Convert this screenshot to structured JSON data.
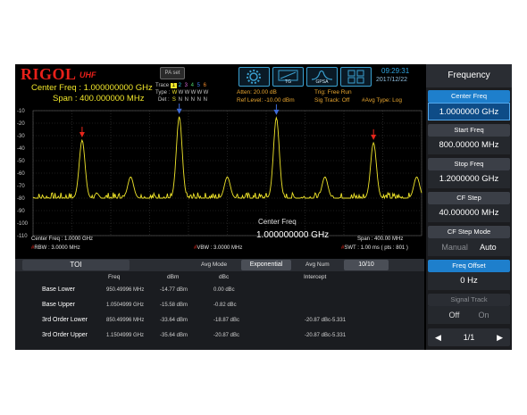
{
  "brand": {
    "name": "RIGOL",
    "suffix": "UHF"
  },
  "header": {
    "center_freq": "Center Freq : 1.000000000 GHz",
    "span": "Span : 400.000000 MHz",
    "pa_button": "PA set",
    "trace_label": "Trace",
    "trace_nums": [
      "1",
      "2",
      "3",
      "4",
      "5",
      "6"
    ],
    "type_label": "Type :",
    "type_vals": [
      "W",
      "W",
      "W",
      "W",
      "W",
      "W"
    ],
    "det_label": "Det :",
    "det_vals": [
      "S",
      "N",
      "N",
      "N",
      "N",
      "N"
    ],
    "atten": "Atten: 20.00 dB",
    "ref_level": "Ref Level: -10.00 dBm",
    "trig": "Trig: Free Run",
    "sig_track": "Sig Track: Off",
    "avg_type": "#Avg Type: Log",
    "icons": [
      {
        "name": "settings-gear-icon",
        "label": ""
      },
      {
        "name": "tg-icon",
        "label": "TG"
      },
      {
        "name": "gpsa-icon",
        "label": "GPSA"
      },
      {
        "name": "layout-grid-icon",
        "label": ""
      }
    ],
    "time": "09:29:31",
    "date": "2017/12/22"
  },
  "plot": {
    "y_ticks": [
      "-10",
      "-20",
      "-30",
      "-40",
      "-50",
      "-60",
      "-70",
      "-80",
      "-90",
      "-100",
      "-110"
    ],
    "center_overlay_label": "Center Freq",
    "center_overlay_value": "1.000000000 GHz",
    "bottom_left": "Center Freq : 1.0000 GHz",
    "rbw": "RBW : 3.0000 MHz",
    "vbw": "VBW : 3.0000 MHz",
    "span": "Span : 400.00 MHz",
    "swt": "SWT : 1.00 ms ( pts : 801 )"
  },
  "chart_data": {
    "type": "line",
    "title": "",
    "xlabel": "",
    "ylabel": "",
    "ylim": [
      -110,
      -10
    ],
    "xlim": [
      800,
      1200
    ],
    "x_unit": "MHz",
    "y_unit": "dBm",
    "noise_floor": -80,
    "peaks": [
      {
        "x": 850.5,
        "y": -33.6
      },
      {
        "x": 900.5,
        "y": -63.0
      },
      {
        "x": 950.5,
        "y": -14.8
      },
      {
        "x": 1000.0,
        "y": -63.0
      },
      {
        "x": 1050.5,
        "y": -15.6
      },
      {
        "x": 1100.5,
        "y": -63.0
      },
      {
        "x": 1150.5,
        "y": -35.6
      },
      {
        "x": 1195.0,
        "y": -63.0
      }
    ],
    "markers": [
      {
        "x": 850.5,
        "color": "#e8261b"
      },
      {
        "x": 950.5,
        "color": "#3f6bd8"
      },
      {
        "x": 1050.5,
        "color": "#3f6bd8"
      },
      {
        "x": 1150.5,
        "color": "#e8261b"
      }
    ],
    "grid": true
  },
  "toi": {
    "title": "TOI",
    "avg_mode_label": "Avg Mode",
    "avg_mode_value": "Exponential",
    "avg_num_label": "Avg Num",
    "avg_num_value": "10/10",
    "headers": [
      "Freq",
      "dBm",
      "dBc",
      "Intercept"
    ],
    "rows": [
      {
        "name": "Base Lower",
        "freq": "950.49996 MHz",
        "dbm": "-14.77 dBm",
        "dbc": "0.00 dBc",
        "intercept": ""
      },
      {
        "name": "Base Upper",
        "freq": "1.0504999 GHz",
        "dbm": "-15.58 dBm",
        "dbc": "-0.82 dBc",
        "intercept": ""
      },
      {
        "name": "3rd Order Lower",
        "freq": "850.49996 MHz",
        "dbm": "-33.64 dBm",
        "dbc": "-18.87 dBc",
        "intercept": "-20.87 dBc-5.331"
      },
      {
        "name": "3rd Order Upper",
        "freq": "1.1504999 GHz",
        "dbm": "-35.64 dBm",
        "dbc": "-20.87 dBc",
        "intercept": "-20.87 dBc-5.331"
      }
    ]
  },
  "menu": {
    "title": "Frequency",
    "items": [
      {
        "label": "Center Freq",
        "value": "1.0000000 GHz"
      },
      {
        "label": "Start Freq",
        "value": "800.00000 MHz"
      },
      {
        "label": "Stop Freq",
        "value": "1.2000000 GHz"
      },
      {
        "label": "CF Step",
        "value": "40.000000 MHz"
      }
    ],
    "cf_step_mode": {
      "label": "CF Step Mode",
      "opt1": "Manual",
      "opt2": "Auto"
    },
    "freq_offset": {
      "label": "Freq Offset",
      "value": "0 Hz"
    },
    "signal_track": {
      "label": "Signal Track",
      "opt1": "Off",
      "opt2": "On"
    },
    "page": "1/1"
  }
}
